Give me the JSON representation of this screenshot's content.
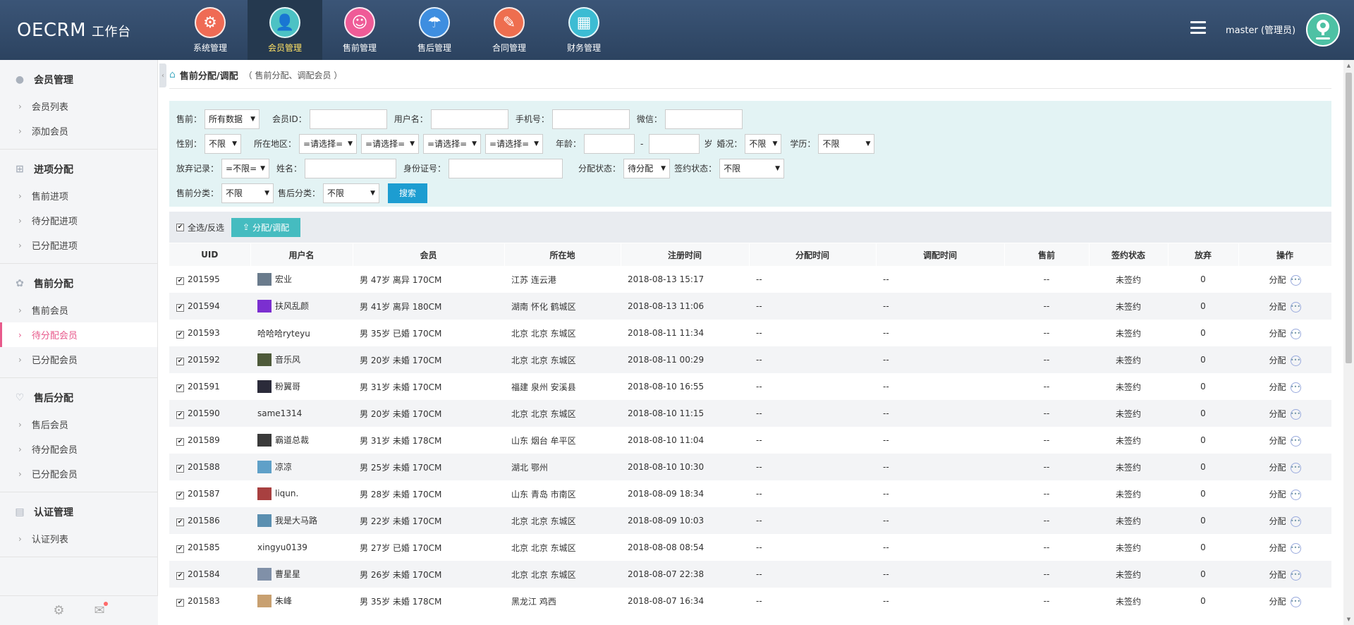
{
  "brand": {
    "name": "OECRM",
    "sub": "工作台"
  },
  "topnav": [
    {
      "label": "系统管理",
      "icon": "gear-icon",
      "color": "#ef6b55"
    },
    {
      "label": "会员管理",
      "icon": "user-icon",
      "color": "#4cc2c4",
      "active": true
    },
    {
      "label": "售前管理",
      "icon": "smiley-icon",
      "color": "#ef5b97"
    },
    {
      "label": "售后管理",
      "icon": "umbrella-icon",
      "color": "#3e8ee0"
    },
    {
      "label": "合同管理",
      "icon": "contract-icon",
      "color": "#ee6e4f"
    },
    {
      "label": "财务管理",
      "icon": "finance-board-icon",
      "color": "#3cbcd3"
    }
  ],
  "user": {
    "name": "master (管理员)"
  },
  "sidebar": [
    {
      "title": "会员管理",
      "icon": "person-icon",
      "items": [
        "会员列表",
        "添加会员"
      ]
    },
    {
      "title": "进项分配",
      "icon": "sitemap-icon",
      "items": [
        "售前进项",
        "待分配进项",
        "已分配进项"
      ]
    },
    {
      "title": "售前分配",
      "icon": "butterfly-icon",
      "items": [
        "售前会员",
        "待分配会员",
        "已分配会员"
      ]
    },
    {
      "title": "售后分配",
      "icon": "heart-icon",
      "items": [
        "售后会员",
        "待分配会员",
        "已分配会员"
      ]
    },
    {
      "title": "认证管理",
      "icon": "document-icon",
      "items": [
        "认证列表"
      ]
    }
  ],
  "sidebar_active": "待分配会员",
  "page": {
    "title": "售前分配/调配",
    "desc": "（ 售前分配、调配会员 ）"
  },
  "filter": {
    "presale_label": "售前：",
    "presale_value": "所有数据",
    "uid_label": "会员ID：",
    "username_label": "用户名：",
    "phone_label": "手机号：",
    "wechat_label": "微信：",
    "gender_label": "性别：",
    "gender_value": "不限",
    "region_label": "所在地区：",
    "region_values": [
      "=请选择=",
      "=请选择=",
      "=请选择=",
      "=请选择="
    ],
    "age_label": "年龄：",
    "age_dash": "-",
    "age_unit": "岁",
    "marriage_label": "婚况：",
    "marriage_value": "不限",
    "edu_label": "学历：",
    "edu_value": "不限",
    "abandon_label": "放弃记录：",
    "abandon_value": "=不限=",
    "name_label": "姓名：",
    "idcard_label": "身份证号：",
    "assign_label": "分配状态：",
    "assign_value": "待分配",
    "sign_label": "签约状态：",
    "sign_value": "不限",
    "precat_label": "售前分类：",
    "precat_value": "不限",
    "postcat_label": "售后分类：",
    "postcat_value": "不限",
    "search_label": "搜索"
  },
  "actions": {
    "select_all": "全选/反选",
    "assign": "分配/调配"
  },
  "table": {
    "headers": [
      "UID",
      "用户名",
      "会员",
      "所在地",
      "注册时间",
      "分配时间",
      "调配时间",
      "售前",
      "签约状态",
      "放弃",
      "操作"
    ],
    "op_label": "分配",
    "rows": [
      {
        "uid": "201595",
        "name": "宏业",
        "avatar": "#6a7b8c",
        "member": "男 47岁 离异 170CM",
        "loc": "江苏 连云港",
        "reg": "2018-08-13 15:17",
        "assign": "--",
        "adjust": "--",
        "pre": "--",
        "sign": "未签约",
        "abandon": "0"
      },
      {
        "uid": "201594",
        "name": "扶风乱颜",
        "avatar": "#7b2fd0",
        "member": "男 41岁 离异 180CM",
        "loc": "湖南 怀化 鹤城区",
        "reg": "2018-08-13 11:06",
        "assign": "--",
        "adjust": "--",
        "pre": "--",
        "sign": "未签约",
        "abandon": "0"
      },
      {
        "uid": "201593",
        "name": "哈哈哈ryteyu",
        "avatar": "",
        "member": "男 35岁 已婚 170CM",
        "loc": "北京 北京 东城区",
        "reg": "2018-08-11 11:34",
        "assign": "--",
        "adjust": "--",
        "pre": "--",
        "sign": "未签约",
        "abandon": "0"
      },
      {
        "uid": "201592",
        "name": "音乐风",
        "avatar": "#4e5a3a",
        "member": "男 20岁 未婚 170CM",
        "loc": "北京 北京 东城区",
        "reg": "2018-08-11 00:29",
        "assign": "--",
        "adjust": "--",
        "pre": "--",
        "sign": "未签约",
        "abandon": "0"
      },
      {
        "uid": "201591",
        "name": "粉翼哥",
        "avatar": "#2b2b3a",
        "member": "男 31岁 未婚 170CM",
        "loc": "福建 泉州 安溪县",
        "reg": "2018-08-10 16:55",
        "assign": "--",
        "adjust": "--",
        "pre": "--",
        "sign": "未签约",
        "abandon": "0"
      },
      {
        "uid": "201590",
        "name": "same1314",
        "avatar": "",
        "member": "男 20岁 未婚 170CM",
        "loc": "北京 北京 东城区",
        "reg": "2018-08-10 11:15",
        "assign": "--",
        "adjust": "--",
        "pre": "--",
        "sign": "未签约",
        "abandon": "0"
      },
      {
        "uid": "201589",
        "name": "霸道总裁",
        "avatar": "#3a3a3a",
        "member": "男 31岁 未婚 178CM",
        "loc": "山东 烟台 牟平区",
        "reg": "2018-08-10 11:04",
        "assign": "--",
        "adjust": "--",
        "pre": "--",
        "sign": "未签约",
        "abandon": "0"
      },
      {
        "uid": "201588",
        "name": "凉凉",
        "avatar": "#5fa0c8",
        "member": "男 25岁 未婚 170CM",
        "loc": "湖北 鄂州",
        "reg": "2018-08-10 10:30",
        "assign": "--",
        "adjust": "--",
        "pre": "--",
        "sign": "未签约",
        "abandon": "0"
      },
      {
        "uid": "201587",
        "name": "liqun.",
        "avatar": "#a84040",
        "member": "男 28岁 未婚 170CM",
        "loc": "山东 青岛 市南区",
        "reg": "2018-08-09 18:34",
        "assign": "--",
        "adjust": "--",
        "pre": "--",
        "sign": "未签约",
        "abandon": "0"
      },
      {
        "uid": "201586",
        "name": "我是大马路",
        "avatar": "#5b8fb0",
        "member": "男 22岁 未婚 170CM",
        "loc": "北京 北京 东城区",
        "reg": "2018-08-09 10:03",
        "assign": "--",
        "adjust": "--",
        "pre": "--",
        "sign": "未签约",
        "abandon": "0"
      },
      {
        "uid": "201585",
        "name": "xingyu0139",
        "avatar": "",
        "member": "男 27岁 已婚 170CM",
        "loc": "北京 北京 东城区",
        "reg": "2018-08-08 08:54",
        "assign": "--",
        "adjust": "--",
        "pre": "--",
        "sign": "未签约",
        "abandon": "0"
      },
      {
        "uid": "201584",
        "name": "曹星星",
        "avatar": "#8090a8",
        "member": "男 26岁 未婚 170CM",
        "loc": "北京 北京 东城区",
        "reg": "2018-08-07 22:38",
        "assign": "--",
        "adjust": "--",
        "pre": "--",
        "sign": "未签约",
        "abandon": "0"
      },
      {
        "uid": "201583",
        "name": "朱峰",
        "avatar": "#c8a070",
        "member": "男 35岁 未婚 178CM",
        "loc": "黑龙江 鸡西",
        "reg": "2018-08-07 16:34",
        "assign": "--",
        "adjust": "--",
        "pre": "--",
        "sign": "未签约",
        "abandon": "0"
      }
    ]
  }
}
